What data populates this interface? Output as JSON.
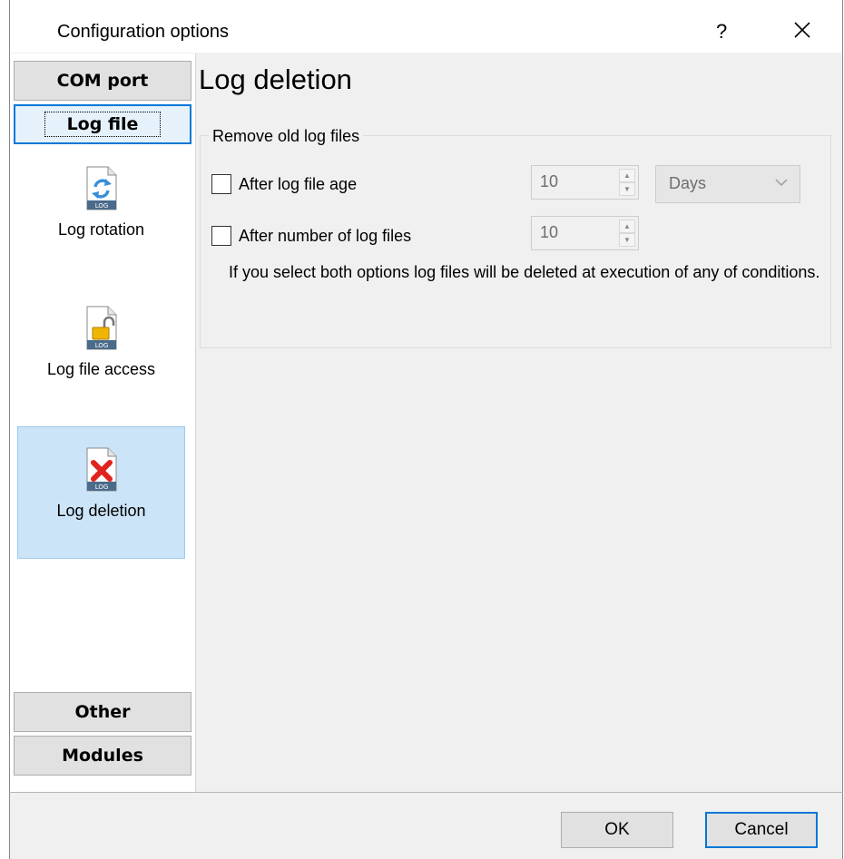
{
  "window": {
    "title": "Configuration options",
    "help": "?"
  },
  "nav": {
    "top_buttons": [
      {
        "label": "COM port",
        "active": false
      },
      {
        "label": "Log file",
        "active": true
      }
    ],
    "items": [
      {
        "label": "Log rotation",
        "icon": "log-rotation-icon"
      },
      {
        "label": "Log file access",
        "icon": "log-file-access-icon"
      },
      {
        "label": "Log deletion",
        "icon": "log-deletion-icon",
        "selected": true
      }
    ],
    "bottom_buttons": [
      {
        "label": "Other"
      },
      {
        "label": "Modules"
      }
    ]
  },
  "content": {
    "title": "Log deletion",
    "group": {
      "legend": "Remove old log files",
      "age_option": {
        "label": "After log file age",
        "checked": false,
        "value": "10",
        "unit": "Days"
      },
      "count_option": {
        "label": "After number of log files",
        "checked": false,
        "value": "10"
      },
      "info": "If you select both options log files will be deleted at execution of any of conditions."
    }
  },
  "footer": {
    "ok": "OK",
    "cancel": "Cancel"
  },
  "colors": {
    "accent": "#0078d7",
    "selected_bg": "#cce4f7",
    "window_bg": "#f0f0f0"
  }
}
